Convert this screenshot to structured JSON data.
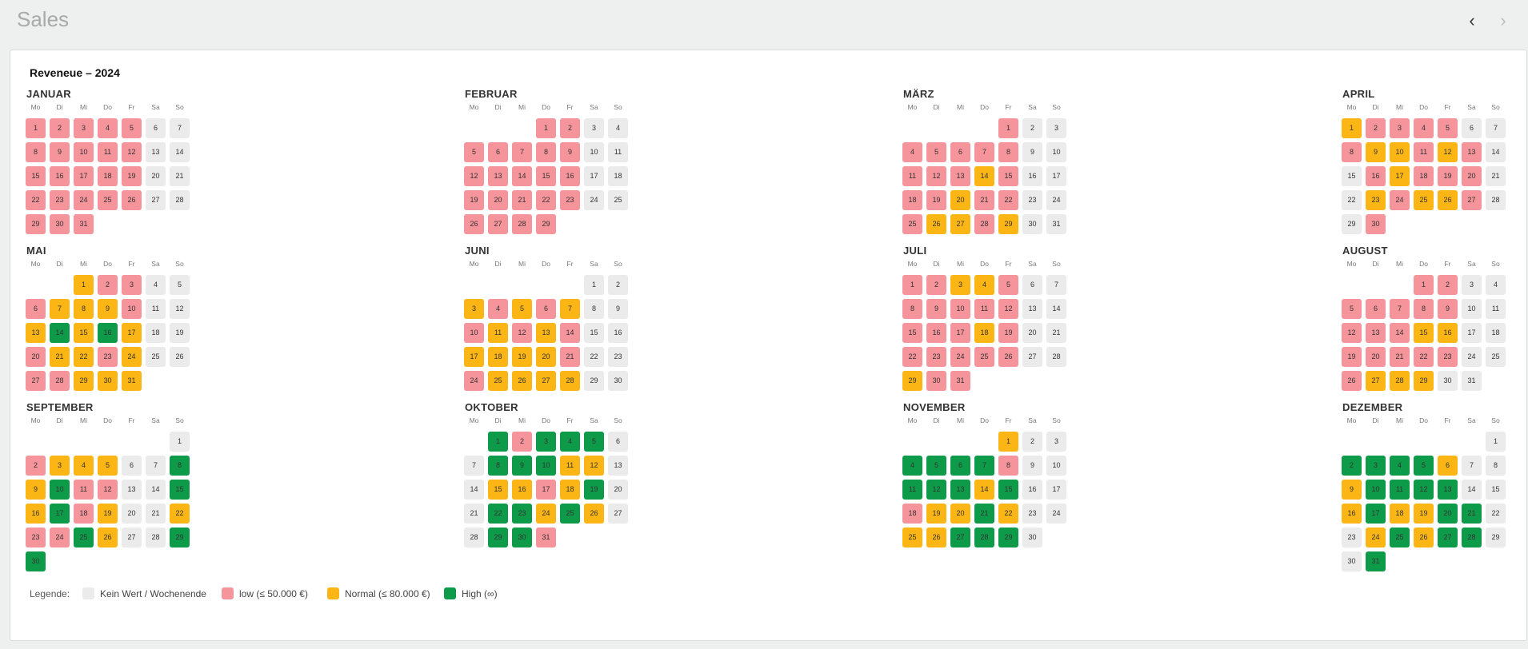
{
  "app": {
    "title": "Sales"
  },
  "nav": {
    "prev_icon": "chevron-left-icon",
    "next_icon": "chevron-right-icon",
    "prev_glyph": "‹",
    "next_glyph": "›"
  },
  "calendar": {
    "title": "Reveneue – 2024",
    "weekdays": [
      "Mo",
      "Di",
      "Mi",
      "Do",
      "Fr",
      "Sa",
      "So"
    ],
    "colors": {
      "none": "#ebebeb",
      "low": "#f5949a",
      "normal": "#fbb514",
      "high": "#0d9b49"
    },
    "level_codes": {
      "0": "none",
      "1": "low",
      "2": "normal",
      "3": "high"
    },
    "months": [
      {
        "name": "JANUAR",
        "first_weekday": 0,
        "days": 31,
        "levels": "1111100111110011111001111100111"
      },
      {
        "name": "FEBRUAR",
        "first_weekday": 3,
        "days": 29,
        "levels": "11001111100111110011111001111"
      },
      {
        "name": "MÄRZ",
        "first_weekday": 4,
        "days": 31,
        "levels": "1001111100111210011211001221200"
      },
      {
        "name": "APRIL",
        "first_weekday": 0,
        "days": 30,
        "levels": "211110012212100121110021221001"
      },
      {
        "name": "MAI",
        "first_weekday": 2,
        "days": 31,
        "levels": "2110012221002323200122120011222"
      },
      {
        "name": "JUNI",
        "first_weekday": 5,
        "days": 30,
        "levels": "002121200121210022221001222200"
      },
      {
        "name": "JULI",
        "first_weekday": 0,
        "days": 31,
        "levels": "1122100111110011121001111100211"
      },
      {
        "name": "AUGUST",
        "first_weekday": 3,
        "days": 31,
        "levels": "1100111110011122001111100122200"
      },
      {
        "name": "SEPTEMBER",
        "first_weekday": 6,
        "days": 30,
        "levels": "012220032311003231200211320033"
      },
      {
        "name": "OKTOBER",
        "first_weekday": 1,
        "days": 31,
        "levels": "3133300333220022123003323200331"
      },
      {
        "name": "NOVEMBER",
        "first_weekday": 4,
        "days": 30,
        "levels": "200333310033323001223200223330"
      },
      {
        "name": "DEZEMBER",
        "first_weekday": 6,
        "days": 31,
        "levels": "0333320023333002322330023233003"
      }
    ]
  },
  "legend": {
    "label": "Legende:",
    "items": [
      {
        "key": "none",
        "text": "Kein Wert / Wochenende"
      },
      {
        "key": "low",
        "text": "low (≤ 50.000 €)"
      },
      {
        "key": "normal",
        "text": "Normal (≤ 80.000 €)"
      },
      {
        "key": "high",
        "text": "High (∞)"
      }
    ]
  }
}
